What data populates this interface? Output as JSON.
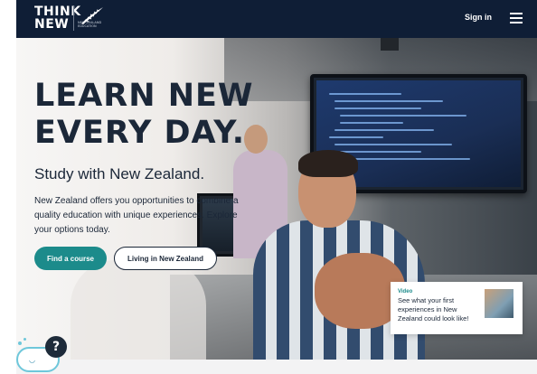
{
  "header": {
    "logo_line1": "THINK",
    "logo_line2": "NEW",
    "nz_text": "NEW ZEALAND EDUCATION",
    "signin_label": "Sign in",
    "menu_icon": "hamburger-menu-icon"
  },
  "hero": {
    "title_line1": "LEARN NEW",
    "title_line2": "EVERY DAY.",
    "subtitle": "Study with New Zealand.",
    "body": "New Zealand offers you opportunities to combine a quality education with unique experiences. Explore your options today.",
    "primary_button": "Find a course",
    "secondary_button": "Living in New Zealand"
  },
  "video_card": {
    "label": "Video",
    "text": "See what your first experiences in New Zealand could look like!"
  },
  "help_widget": {
    "symbol": "?",
    "icon": "help-chat-icon"
  },
  "colors": {
    "header_bg": "#0f1e36",
    "accent_teal": "#1c8b8b",
    "text_dark": "#1b2738"
  }
}
